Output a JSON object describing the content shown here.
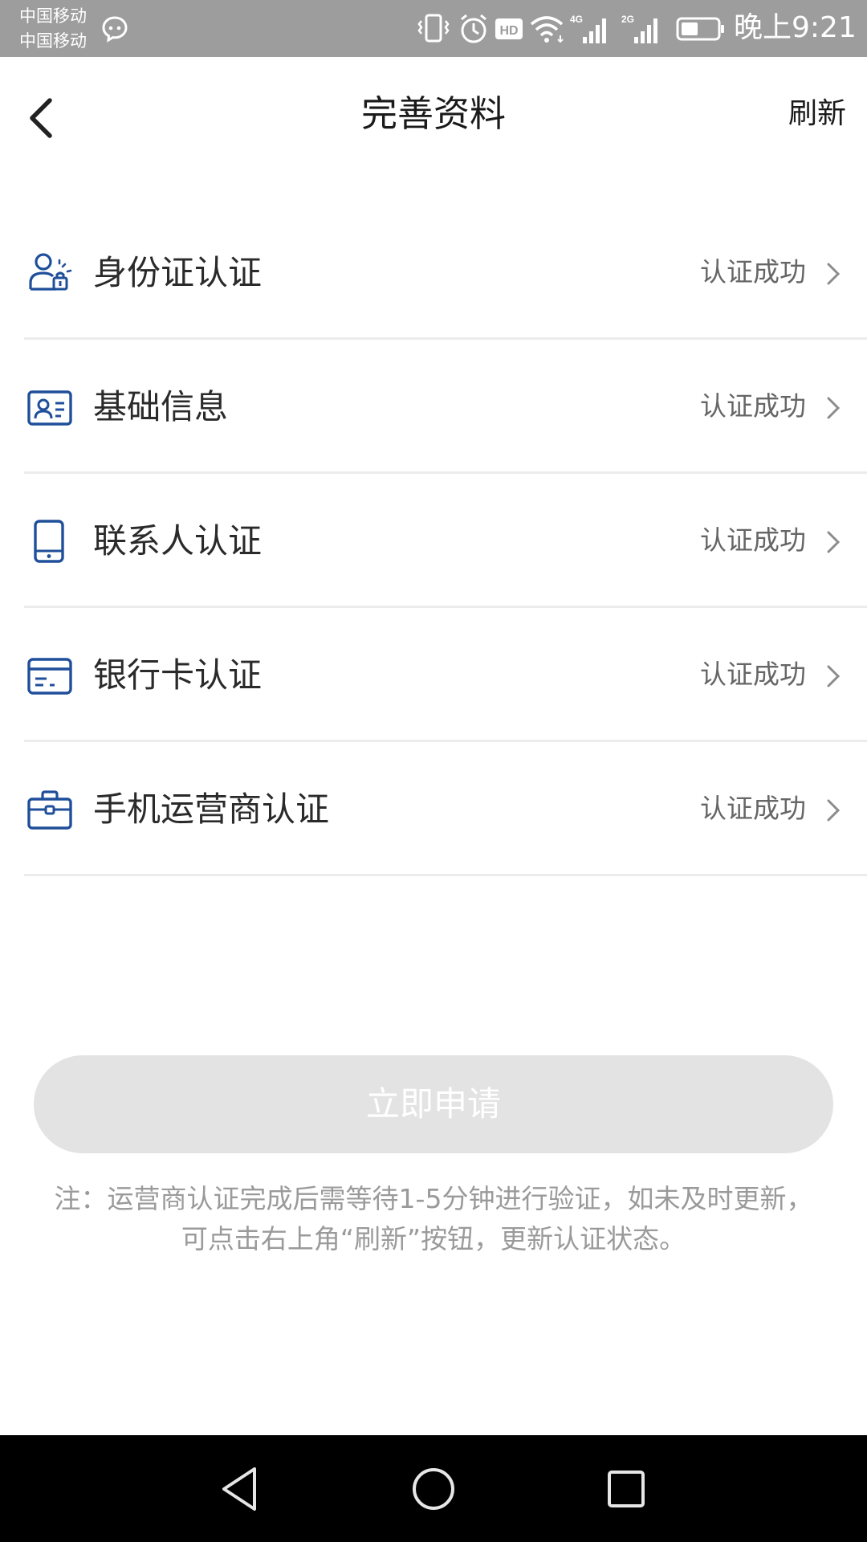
{
  "status_bar": {
    "carrier_1": "中国移动",
    "carrier_2": "中国移动",
    "time": "晚上9:21",
    "icons": [
      "message-icon",
      "vibrate-icon",
      "alarm-icon",
      "hd-icon",
      "wifi-icon",
      "signal-4g-icon",
      "signal-2g-icon",
      "battery-icon"
    ],
    "network_labels": {
      "lte": "4G",
      "gsm": "2G",
      "hd": "HD"
    }
  },
  "header": {
    "title": "完善资料",
    "refresh_label": "刷新",
    "back_icon": "chevron-left-icon"
  },
  "verification_items": [
    {
      "label": "身份证认证",
      "status": "认证成功",
      "icon": "id-person-icon"
    },
    {
      "label": "基础信息",
      "status": "认证成功",
      "icon": "profile-card-icon"
    },
    {
      "label": "联系人认证",
      "status": "认证成功",
      "icon": "phone-icon"
    },
    {
      "label": "银行卡认证",
      "status": "认证成功",
      "icon": "bank-card-icon"
    },
    {
      "label": "手机运营商认证",
      "status": "认证成功",
      "icon": "briefcase-icon"
    }
  ],
  "apply_button": {
    "label": "立即申请"
  },
  "note": {
    "line_1": "注：运营商认证完成后需等待1-5分钟进行验证，如未及时更新，",
    "line_2": "可点击右上角“刷新”按钮，更新认证状态。"
  },
  "system_nav": {
    "icons": [
      "back-triangle-icon",
      "home-circle-icon",
      "recents-square-icon"
    ]
  },
  "colors": {
    "status_bar_bg": "#9d9d9d",
    "icon_blue": "#1f4f9a",
    "button_disabled_bg": "#e3e3e3",
    "divider": "#ececec",
    "nav_bar_bg": "#000000"
  }
}
